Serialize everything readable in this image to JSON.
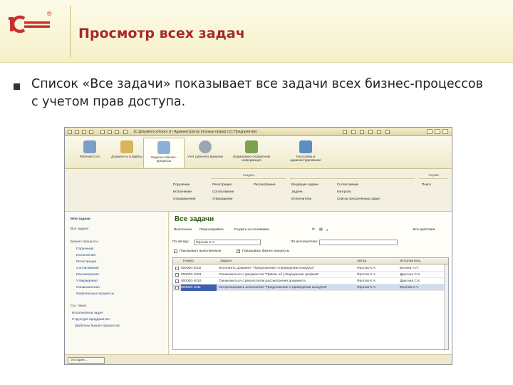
{
  "slide": {
    "logo_text": "1С",
    "title": "Просмотр всех задач",
    "bullet": "Список «Все задачи» показывает все задачи всех бизнес-процессов с учетом прав доступа."
  },
  "window": {
    "title": "1С:Документооборот 8 / Администратор (полные права) (1С:Предприятие)"
  },
  "sections": [
    {
      "label": "Рабочий стол",
      "icon": "desk-icon",
      "color": "#7aa0c8"
    },
    {
      "label": "Документы и файлы",
      "icon": "documents-icon",
      "color": "#d7b65a"
    },
    {
      "label": "Задачи и бизнес-процессы",
      "icon": "tasks-icon",
      "color": "#8fb0d6"
    },
    {
      "label": "Учет рабочего времени",
      "icon": "clock-icon",
      "color": "#9aa6b4"
    },
    {
      "label": "Нормативно-справочная информация",
      "icon": "books-icon",
      "color": "#7fa24f"
    },
    {
      "label": "Настройка и администрирование",
      "icon": "settings-icon",
      "color": "#5b8fc4"
    }
  ],
  "action_groups": [
    {
      "head": "",
      "cols": [
        [
          "Поручение",
          "Исполнение",
          "Ознакомление"
        ]
      ]
    },
    {
      "head": "Создать",
      "cols": [
        [
          "Регистрация",
          "Согласование",
          "Утверждение"
        ],
        [
          "Рассмотрение"
        ]
      ]
    },
    {
      "head": "",
      "cols": [
        [
          "Входящие задачи",
          "Задачи",
          "Исполнители"
        ],
        [
          "Согласование",
          "Контроль",
          "Список просроченных задач"
        ]
      ]
    },
    {
      "head": "Сервис",
      "cols": [
        [
          "Поиск"
        ]
      ]
    }
  ],
  "sidebar": {
    "top_items": [
      "Мои задачи",
      "Все задачи"
    ],
    "processes_head": "Бизнес-процессы",
    "processes": [
      "Поручения",
      "Исполнения",
      "Регистрации",
      "Согласования",
      "Рассмотрения",
      "Утверждения",
      "Ознакомления",
      "Комплексные процессы"
    ],
    "see_also_head": "См. также",
    "see_also": [
      "Исполнители задач",
      "Структура предприятия",
      "Шаблоны бизнес-процессов"
    ]
  },
  "content": {
    "title": "Все задачи",
    "toolbar": [
      "Выполнено",
      "Перенаправить",
      "Создать на основании",
      "Все действия"
    ],
    "author_label": "По автору:",
    "author_value": "Фролов К.Ч.",
    "performer_label": "По исполнителю:",
    "show_completed": "Показывать выполненные",
    "show_bp": "Показывать бизнес-процессы",
    "columns": [
      "Номер",
      "Задача",
      "Автор",
      "Исполнитель"
    ],
    "rows": [
      {
        "num": "000000-1002",
        "task": "Исполнить документ \"Предложение о проведении конкурса\"",
        "author": "Фролов К.Ч.",
        "performer": "Белова А.П.",
        "selected": false
      },
      {
        "num": "000000-1003",
        "task": "Ознакомиться с документом \"Приказ об утверждении графика\"",
        "author": "Фролов К.Ч.",
        "performer": "Дрыгина С.К.",
        "selected": false
      },
      {
        "num": "000000-1010",
        "task": "Ознакомиться с результатом рассмотрения документа",
        "author": "Фролов К.Ч.",
        "performer": "Дрыгина С.К.",
        "selected": false
      },
      {
        "num": "000000-1011",
        "task": "Контролировать исполнение \"Предложение о проведении конкурса\"",
        "author": "Фролов К.Ч.",
        "performer": "Фролов К.Ч.",
        "selected": true
      }
    ]
  },
  "status": {
    "history": "История..."
  }
}
